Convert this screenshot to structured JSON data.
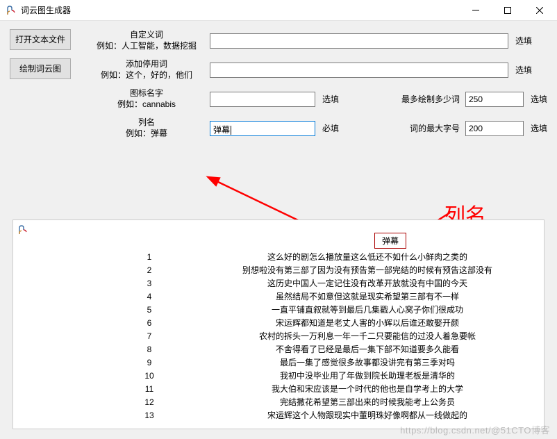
{
  "window": {
    "title": "词云图生成器"
  },
  "buttons": {
    "open_file": "打开文本文件",
    "draw_cloud": "绘制词云图"
  },
  "fields": {
    "custom_words": {
      "label_line1": "自定义词",
      "label_line2": "例如：人工智能，数据挖掘",
      "value": "",
      "hint": "选填"
    },
    "stop_words": {
      "label_line1": "添加停用词",
      "label_line2": "例如：这个，好的，他们",
      "value": "",
      "hint": "选填"
    },
    "icon_name": {
      "label_line1": "图标名字",
      "label_line2": "例如：cannabis",
      "value": "",
      "hint": "选填"
    },
    "max_words": {
      "label": "最多绘制多少词",
      "value": "250",
      "hint": "选填"
    },
    "column_name": {
      "label_line1": "列名",
      "label_line2": "例如：弹幕",
      "value": "弹幕",
      "hint": "必填"
    },
    "max_font": {
      "label": "词的最大字号",
      "value": "200",
      "hint": "选填"
    }
  },
  "annotation": {
    "text": "列名"
  },
  "preview": {
    "header_col": "弹幕",
    "rows": [
      {
        "idx": "1",
        "text": "这么好的剧怎么播放量这么低还不如什么小鲜肉之类的"
      },
      {
        "idx": "2",
        "text": "别想啦没有第三部了因为没有预告第一部完结的时候有预告这部没有"
      },
      {
        "idx": "3",
        "text": "这历史中国人一定记住没有改革开放就没有中国的今天"
      },
      {
        "idx": "4",
        "text": "虽然结局不如意但这就是现实希望第三部有不一样"
      },
      {
        "idx": "5",
        "text": "一直平铺直叙就等到最后几集戳人心窝子你们很成功"
      },
      {
        "idx": "6",
        "text": "宋运辉都知道是老丈人害的小辉以后谁还敢娶开颜"
      },
      {
        "idx": "7",
        "text": "农村的拆头一万利息一年一千二只要能信的过没人着急要帐"
      },
      {
        "idx": "8",
        "text": "不舍得看了已经是最后一集下部不知道要多久能看"
      },
      {
        "idx": "9",
        "text": "最后一集了感觉很多故事都没讲完有第三季对吗"
      },
      {
        "idx": "10",
        "text": "我初中没毕业用了年做到院长助理老板是清华的"
      },
      {
        "idx": "11",
        "text": "我大伯和宋应该是一个时代的他也是自学考上的大学"
      },
      {
        "idx": "12",
        "text": "完结撒花希望第三部出来的时候我能考上公务员"
      },
      {
        "idx": "13",
        "text": "宋运辉这个人物跟现实中董明珠好像啊都从一线做起的"
      }
    ]
  },
  "watermark": "https://blog.csdn.net/@51CTO博客"
}
